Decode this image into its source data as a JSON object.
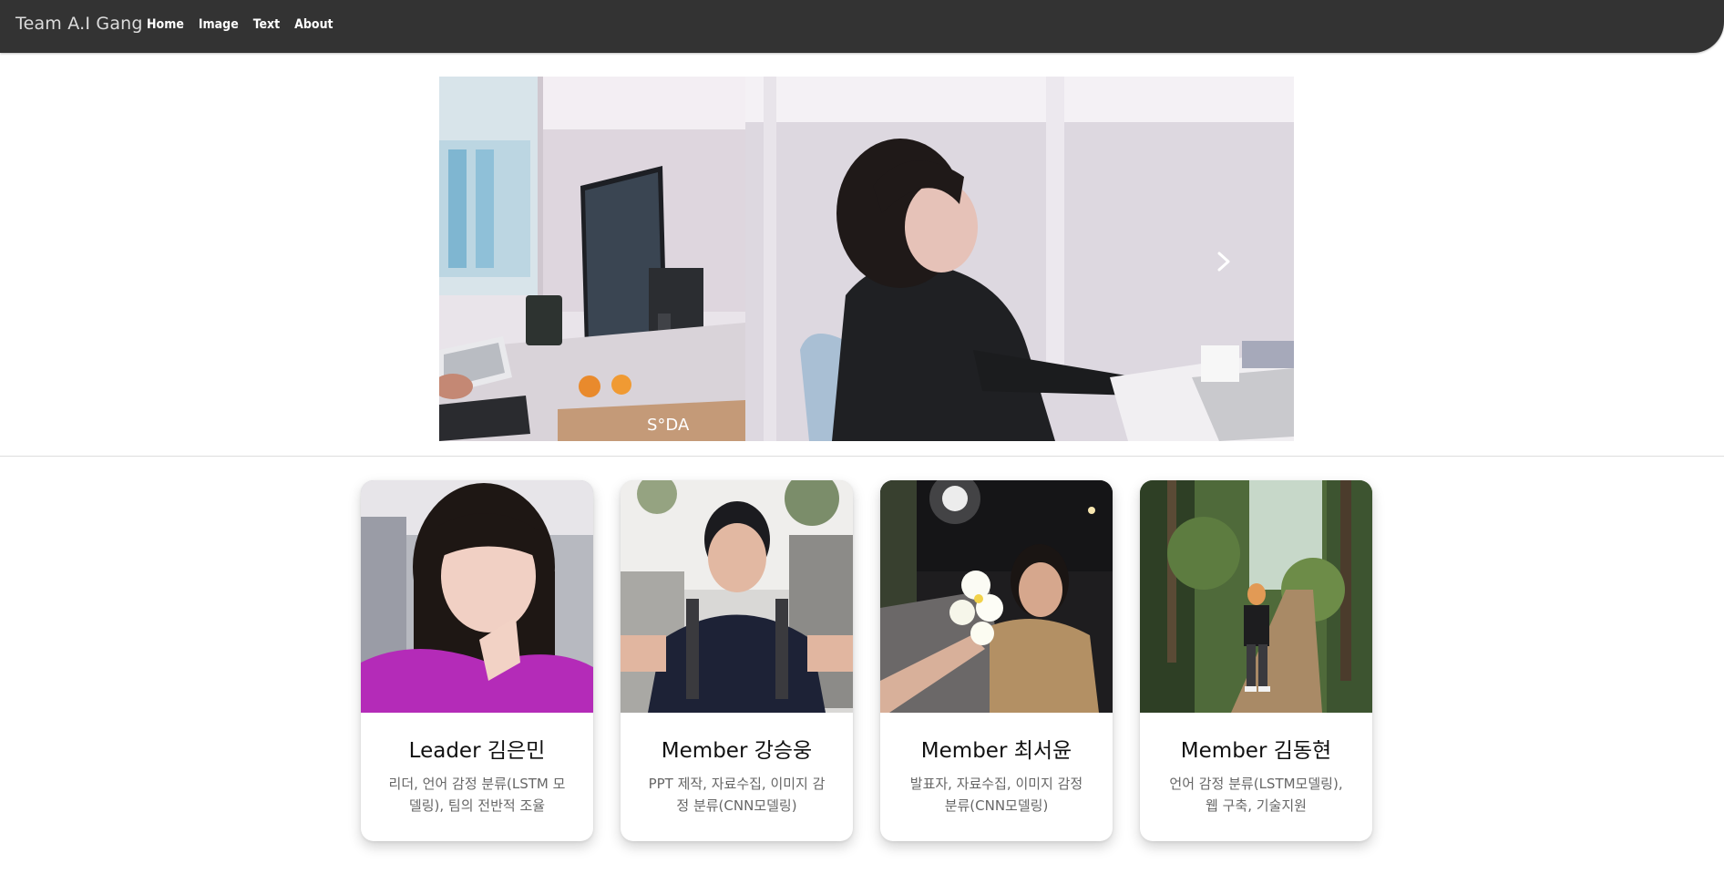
{
  "navbar": {
    "brand": "Team A.I Gang",
    "links": [
      "Home",
      "Image",
      "Text",
      "About"
    ]
  },
  "carousel": {
    "next_icon": "chevron-right-icon",
    "slide_a_watermark": "S°DA"
  },
  "members": [
    {
      "title": "Leader 김은민",
      "description": "리더, 언어 감정 분류(LSTM 모델링), 팀의 전반적 조율"
    },
    {
      "title": "Member 강승웅",
      "description": "PPT 제작, 자료수집, 이미지 감정 분류(CNN모델링)"
    },
    {
      "title": "Member 최서윤",
      "description": "발표자, 자료수집, 이미지 감정 분류(CNN모델링)"
    },
    {
      "title": "Member 김동현",
      "description": "언어 감정 분류(LSTM모델링), 웹 구축, 기술지원"
    }
  ],
  "colors": {
    "navbar_bg": "#333333",
    "nav_text": "#ffffff",
    "brand_text": "#dcdcdc",
    "desc_text": "#666666"
  }
}
